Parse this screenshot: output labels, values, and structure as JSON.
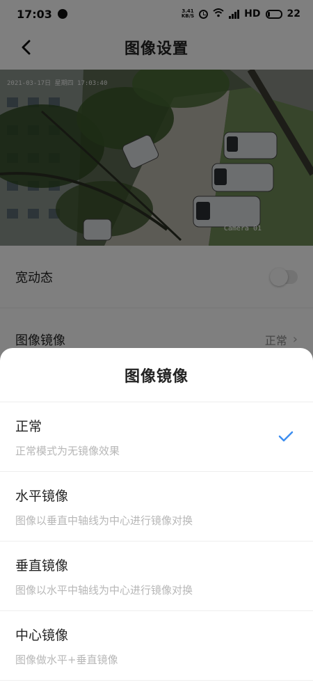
{
  "status_bar": {
    "time": "17:03",
    "net_speed_value": "3.41",
    "net_speed_unit": "KB/S",
    "network_label": "HD",
    "battery_level": "22"
  },
  "header": {
    "title": "图像设置"
  },
  "camera": {
    "timestamp": "2021-03-17日 星期四 17:03:40",
    "label": "Camera 01"
  },
  "settings": {
    "wide_dynamic_label": "宽动态",
    "image_mirror_label": "图像镜像",
    "image_mirror_value": "正常"
  },
  "sheet": {
    "title": "图像镜像",
    "options": [
      {
        "label": "正常",
        "description": "正常模式为无镜像效果",
        "selected": true
      },
      {
        "label": "水平镜像",
        "description": "图像以垂直中轴线为中心进行镜像对换",
        "selected": false
      },
      {
        "label": "垂直镜像",
        "description": "图像以水平中轴线为中心进行镜像对换",
        "selected": false
      },
      {
        "label": "中心镜像",
        "description": "图像做水平+垂直镜像",
        "selected": false
      }
    ],
    "accent_color": "#3d8ef0"
  }
}
